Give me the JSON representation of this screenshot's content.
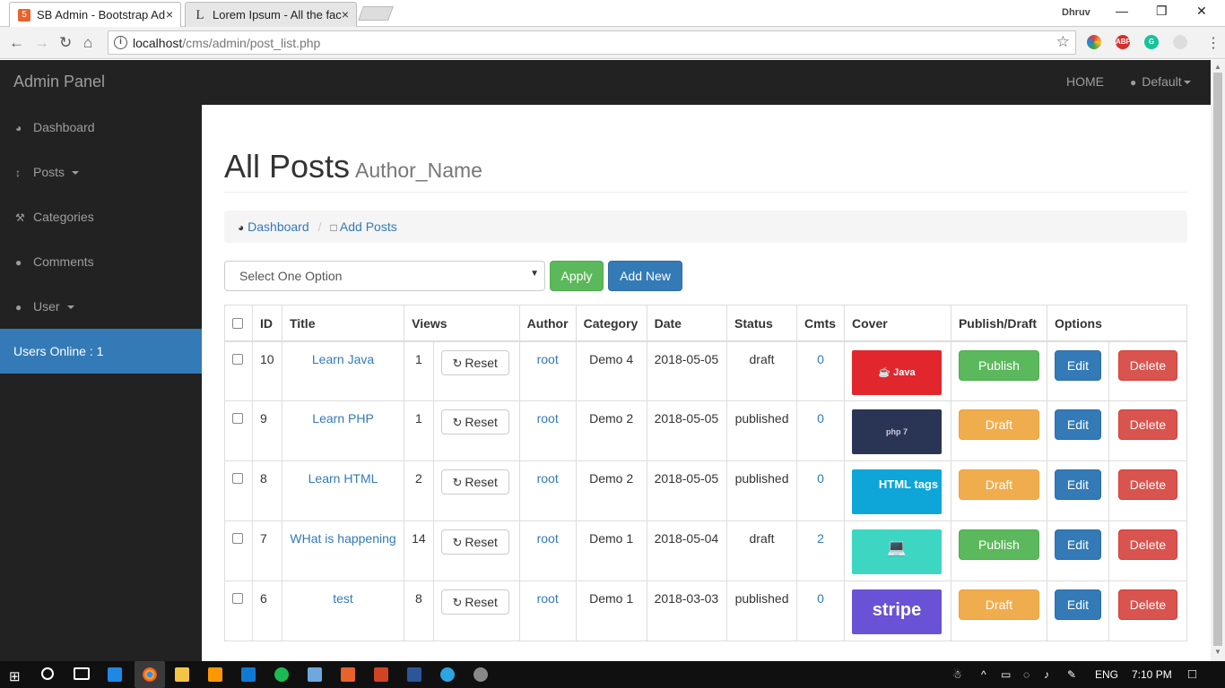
{
  "browser": {
    "tabs": [
      {
        "title": "SB Admin - Bootstrap Ad",
        "close": "×"
      },
      {
        "title": "Lorem Ipsum - All the fac",
        "close": "×"
      }
    ],
    "profile": "Dhruv",
    "url_host": "localhost",
    "url_path": "/cms/admin/post_list.php",
    "window_controls": {
      "minimize": "—",
      "restore": "❐",
      "close": "✕"
    }
  },
  "topnav": {
    "brand": "Admin Panel",
    "home": "HOME",
    "user": "Default"
  },
  "sidebar": {
    "items": [
      {
        "label": "Dashboard",
        "icon": "dashboard-icon"
      },
      {
        "label": "Posts",
        "icon": "arrows-v-icon"
      },
      {
        "label": "Categories",
        "icon": "wrench-icon"
      },
      {
        "label": "Comments",
        "icon": "comment-icon"
      },
      {
        "label": "User",
        "icon": "user-icon"
      }
    ],
    "users_online": "Users Online : 1"
  },
  "page": {
    "title": "All Posts",
    "subtitle": "Author_Name",
    "breadcrumb": [
      "Dashboard",
      "Add Posts"
    ],
    "bulk_placeholder": "Select One Option",
    "apply": "Apply",
    "add_new": "Add New"
  },
  "table": {
    "headers": [
      "ID",
      "Title",
      "Views",
      "Author",
      "Category",
      "Date",
      "Status",
      "Cmts",
      "Cover",
      "Publish/Draft",
      "Options"
    ],
    "reset_label": "Reset",
    "edit_label": "Edit",
    "delete_label": "Delete",
    "rows": [
      {
        "id": "10",
        "title": "Learn Java",
        "views": "1",
        "author": "root",
        "category": "Demo 4",
        "date": "2018-05-05",
        "status": "draft",
        "cmts": "0",
        "cover": "Java",
        "cover_color": "#e2262d",
        "toggle": "Publish",
        "toggle_type": "publish"
      },
      {
        "id": "9",
        "title": "Learn PHP",
        "views": "1",
        "author": "root",
        "category": "Demo 2",
        "date": "2018-05-05",
        "status": "published",
        "cmts": "0",
        "cover": "php 7",
        "cover_color": "#2a3555",
        "toggle": "Draft",
        "toggle_type": "draft"
      },
      {
        "id": "8",
        "title": "Learn HTML",
        "views": "2",
        "author": "root",
        "category": "Demo 2",
        "date": "2018-05-05",
        "status": "published",
        "cmts": "0",
        "cover": "HTML tags",
        "cover_color": "#0ea5d8",
        "toggle": "Draft",
        "toggle_type": "draft"
      },
      {
        "id": "7",
        "title": "WHat is happening",
        "views": "14",
        "author": "root",
        "category": "Demo 1",
        "date": "2018-05-04",
        "status": "draft",
        "cmts": "2",
        "cover": "",
        "cover_color": "#3dd6c3",
        "toggle": "Publish",
        "toggle_type": "publish"
      },
      {
        "id": "6",
        "title": "test",
        "views": "8",
        "author": "root",
        "category": "Demo 1",
        "date": "2018-03-03",
        "status": "published",
        "cmts": "0",
        "cover": "stripe",
        "cover_color": "#6a52d6",
        "toggle": "Draft",
        "toggle_type": "draft"
      }
    ]
  },
  "taskbar": {
    "language": "ENG",
    "time": "7:10 PM"
  }
}
